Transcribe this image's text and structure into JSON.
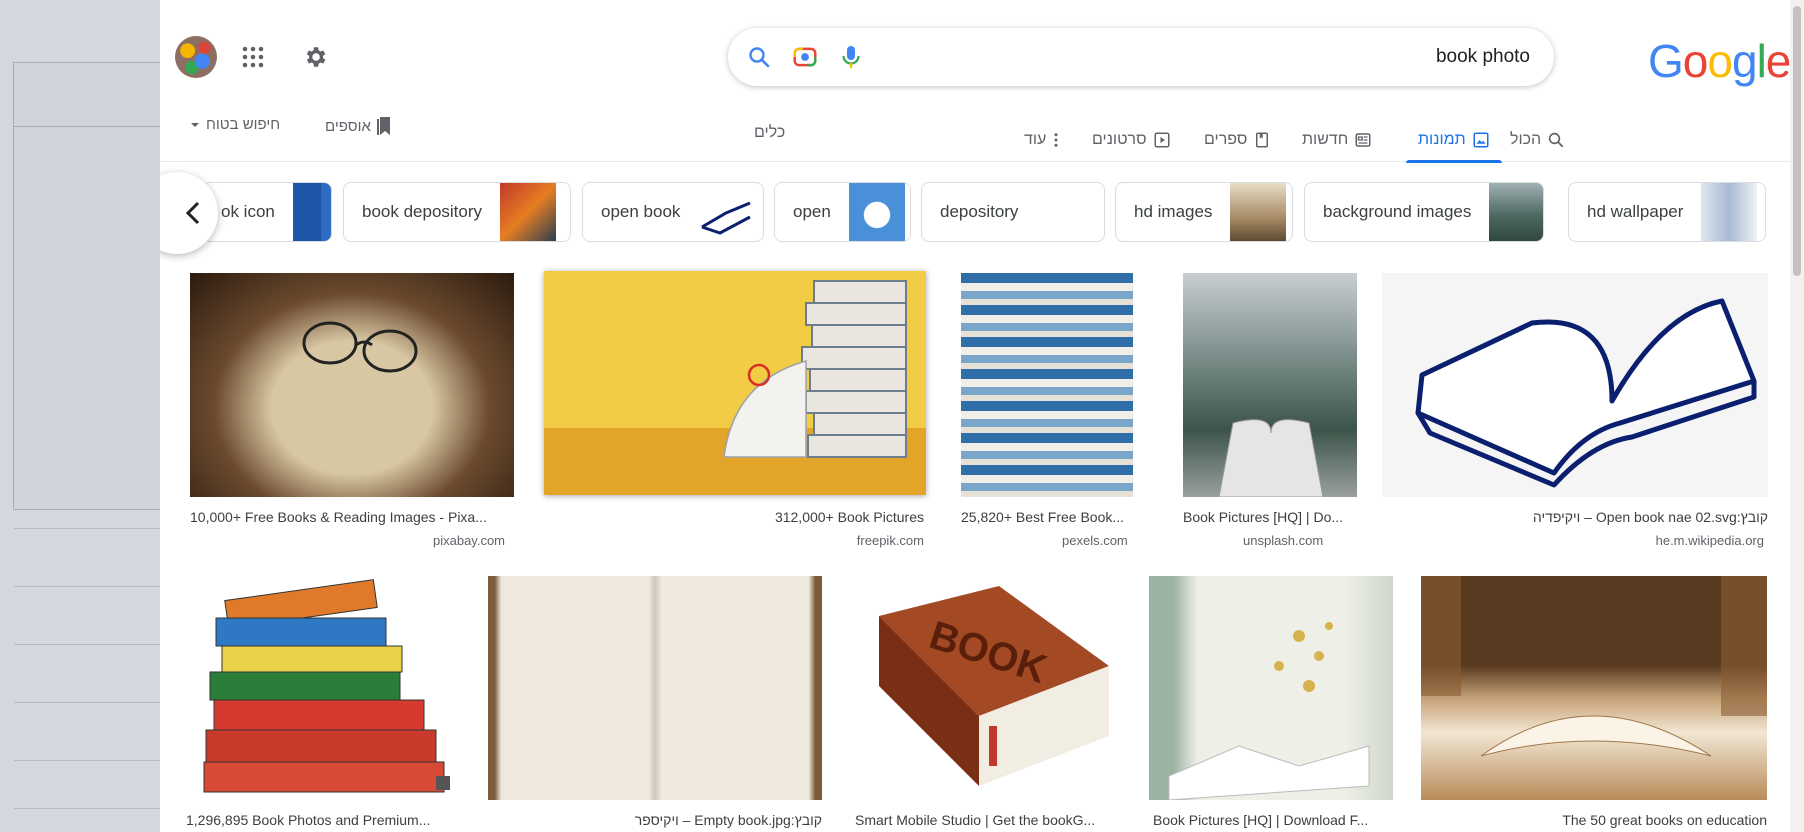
{
  "search": {
    "query": "book photo"
  },
  "logo": "Google",
  "tabs": [
    {
      "label": "הכול"
    },
    {
      "label": "תמונות"
    },
    {
      "label": "חדשות"
    },
    {
      "label": "ספרים"
    },
    {
      "label": "סרטונים"
    },
    {
      "label": "עוד"
    }
  ],
  "tools_label": "כלים",
  "collections_label": "אוספים",
  "safesearch_label": "חיפוש בטוח",
  "chips": [
    {
      "label": "ok icon"
    },
    {
      "label": "book depository"
    },
    {
      "label": "open book"
    },
    {
      "label": "open"
    },
    {
      "label": "depository"
    },
    {
      "label": "hd images"
    },
    {
      "label": "background images"
    },
    {
      "label": "hd wallpaper"
    }
  ],
  "results": [
    {
      "title": "10,000+ Free Books & Reading Images - Pixa...",
      "source": "pixabay.com"
    },
    {
      "title": "312,000+ Book Pictures",
      "source": "freepik.com"
    },
    {
      "title": "25,820+ Best Free Book...",
      "source": "pexels.com"
    },
    {
      "title": "Book Pictures [HQ] | Do...",
      "source": "unsplash.com"
    },
    {
      "title": "קובץ:Open book nae 02.svg – ויקיפדיה",
      "source": "he.m.wikipedia.org"
    },
    {
      "title": "1,296,895 Book Photos and Premium...",
      "source": ""
    },
    {
      "title": "קובץ:Empty book.jpg – ויקיספר",
      "source": ""
    },
    {
      "title": "Smart Mobile Studio | Get the bookG...",
      "source": ""
    },
    {
      "title": "Book Pictures [HQ] | Download F...",
      "source": ""
    },
    {
      "title": "The 50 great books on education",
      "source": ""
    }
  ],
  "colors": {
    "accent": "#1a73e8",
    "text": "#202124",
    "secondary": "#5f6368"
  }
}
